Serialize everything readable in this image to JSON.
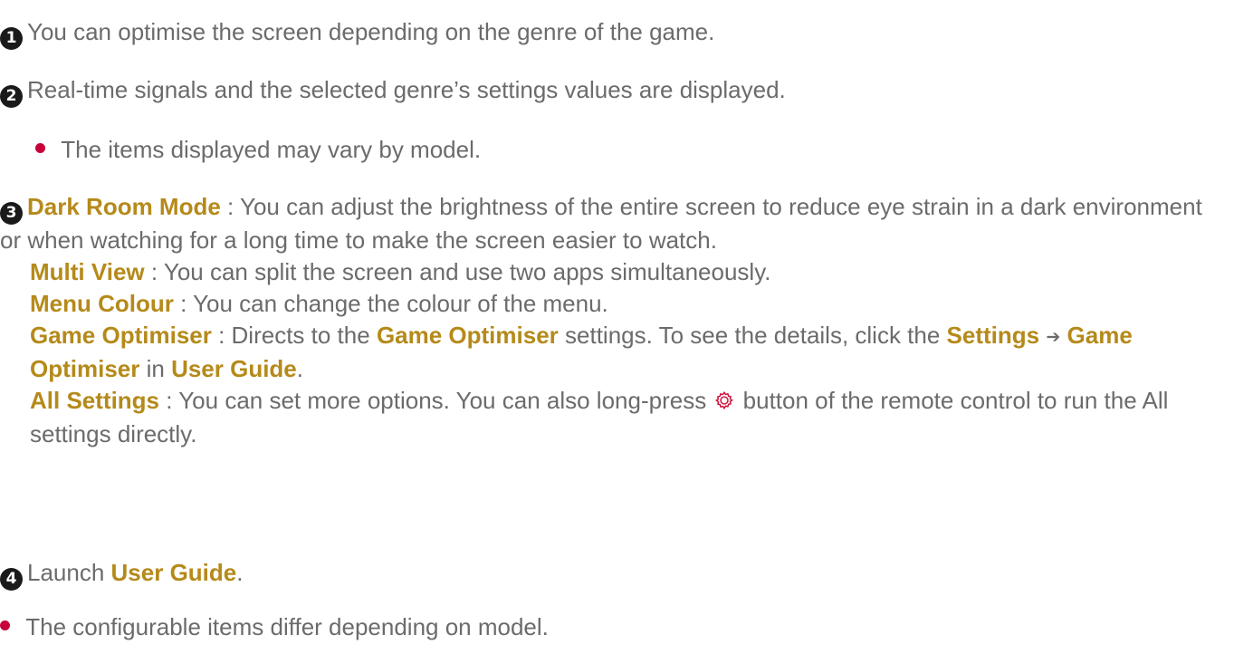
{
  "items": [
    {
      "number": "1",
      "text": "You can optimise the screen depending on the genre of the game."
    },
    {
      "number": "2",
      "text": "Real-time signals and the selected genre’s settings values are displayed."
    },
    {
      "sub_bullet": "The items displayed may vary by model."
    },
    {
      "number": "3",
      "dark_room_mode": {
        "term": "Dark Room Mode",
        "text": " : You can adjust the brightness of the entire screen to reduce eye strain in a dark environment or when watching for a long time to make the screen easier to watch."
      },
      "multi_view": {
        "term": "Multi View",
        "text": " : You can split the screen and use two apps simultaneously."
      },
      "menu_colour": {
        "term": "Menu Colour",
        "text": " : You can change the colour of the menu."
      },
      "game_optimiser": {
        "term": "Game Optimiser",
        "text1": " : Directs to the ",
        "term2": "Game Optimiser",
        "text2": " settings. To see the details, click the ",
        "term3": "Settings",
        "arrow": "➔",
        "term4": "Game Optimiser",
        "text3": " in ",
        "term5": "User Guide",
        "text4": "."
      },
      "all_settings": {
        "term": "All Settings",
        "text1": " : You can set more options. You can also long-press ",
        "icon": "settings-gear-icon",
        "text2": " button of the remote control to run the All settings directly."
      }
    },
    {
      "number": "4",
      "text1": "Launch ",
      "term": "User Guide",
      "text2": "."
    }
  ],
  "footer_note": "The configurable items differ depending on model.",
  "colors": {
    "body_text": "#6b6b6b",
    "highlight": "#b58a1a",
    "bullet": "#c8003a",
    "gear_icon": "#d0103a"
  }
}
